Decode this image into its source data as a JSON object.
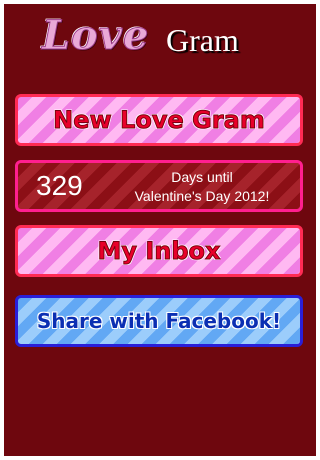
{
  "logo": {
    "love": "Love",
    "gram": "Gram"
  },
  "menu": {
    "new_love_gram": "New Love Gram",
    "my_inbox": "My Inbox",
    "share_facebook": "Share with Facebook!"
  },
  "countdown": {
    "days": "329",
    "caption_line1": "Days until",
    "caption_line2": "Valentine's Day 2012!"
  },
  "colors": {
    "background": "#6e070e",
    "pink_button_border": "#ff2b54",
    "pink_button_text": "#e8002a",
    "blue_button_border": "#2a1fd8",
    "blue_button_text": "#0b2fb3",
    "countdown_border": "#ff1f8f"
  }
}
